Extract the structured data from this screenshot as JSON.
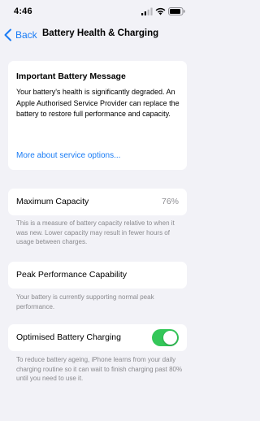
{
  "status_bar": {
    "time": "4:46",
    "icons": [
      "signal-icon",
      "wifi-icon",
      "battery-icon"
    ]
  },
  "nav": {
    "back_label": "Back",
    "title": "Battery Health & Charging"
  },
  "message": {
    "title": "Important Battery Message",
    "body": "Your battery's health is significantly degraded. An Apple Authorised Service Provider can replace the battery to restore full performance and capacity.",
    "link": "More about service options..."
  },
  "maximum_capacity": {
    "label": "Maximum Capacity",
    "value": "76%",
    "footnote": "This is a measure of battery capacity relative to when it was new. Lower capacity may result in fewer hours of usage between charges."
  },
  "peak_performance": {
    "label": "Peak Performance Capability",
    "footnote": "Your battery is currently supporting normal peak performance."
  },
  "optimised_charging": {
    "label": "Optimised Battery Charging",
    "enabled": true,
    "footnote": "To reduce battery ageing, iPhone learns from your daily charging routine so it can wait to finish charging past 80% until you need to use it."
  },
  "colors": {
    "accent": "#1a7cf5",
    "toggle_on": "#34c759",
    "background": "#f2f2f7"
  }
}
